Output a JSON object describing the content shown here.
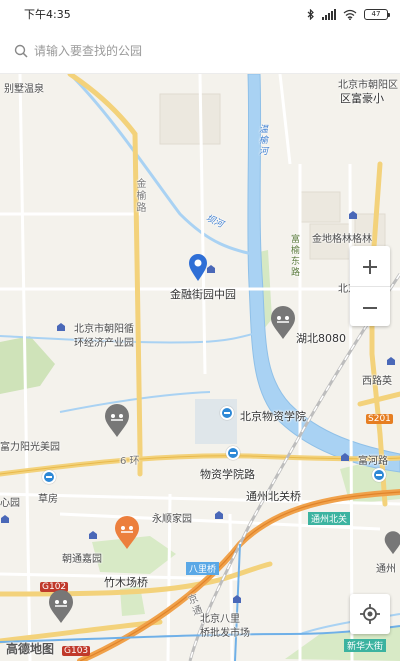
{
  "status_bar": {
    "time": "下午4:35",
    "battery": "47"
  },
  "search": {
    "placeholder": "请输入要查找的公园"
  },
  "map": {
    "labels": {
      "area_top_right": "北京市朝阳区",
      "area_top_right2": "区富豪小",
      "top_left_place": "别墅温泉",
      "jinyu_road": "金榆路",
      "river_name": "坝河",
      "fuyu_road": "富榆东路",
      "river_wenyu": "温榆河",
      "jingeling": "金地格林格林",
      "jinrong_park": "金融街园中园",
      "bei_jiang": "北京",
      "zhaonan": "湖北8080",
      "chaoyang_xunhuan": "北京市朝阳循",
      "chaoyang_xunhuan2": "环经济产业园",
      "xiyuan": "西路英",
      "jingmin_pl": "北京物资学院",
      "s201": "S201",
      "fuhe_garden": "富力阳光美园",
      "six_ring": "6 环",
      "fuhe_road": "富河路",
      "wuzi_road": "物资学院路",
      "caofang": "草房",
      "xin": "心园",
      "tongzhou_bridge": "通州北关桥",
      "tongzhou_beiguan": "通州北关",
      "yongshun": "永顺家园",
      "chaotong": "朝通嘉园",
      "g102": "G102",
      "zhumu": "竹木场桥",
      "balibridge": "八里桥",
      "jingcheng": "京通",
      "beijing_bali": "北京八里",
      "qiaopi": "桥批发市场",
      "tongzhou_right": "通州",
      "g103": "G103",
      "xinhua_street": "新华大街",
      "logo": "高德地图"
    }
  }
}
